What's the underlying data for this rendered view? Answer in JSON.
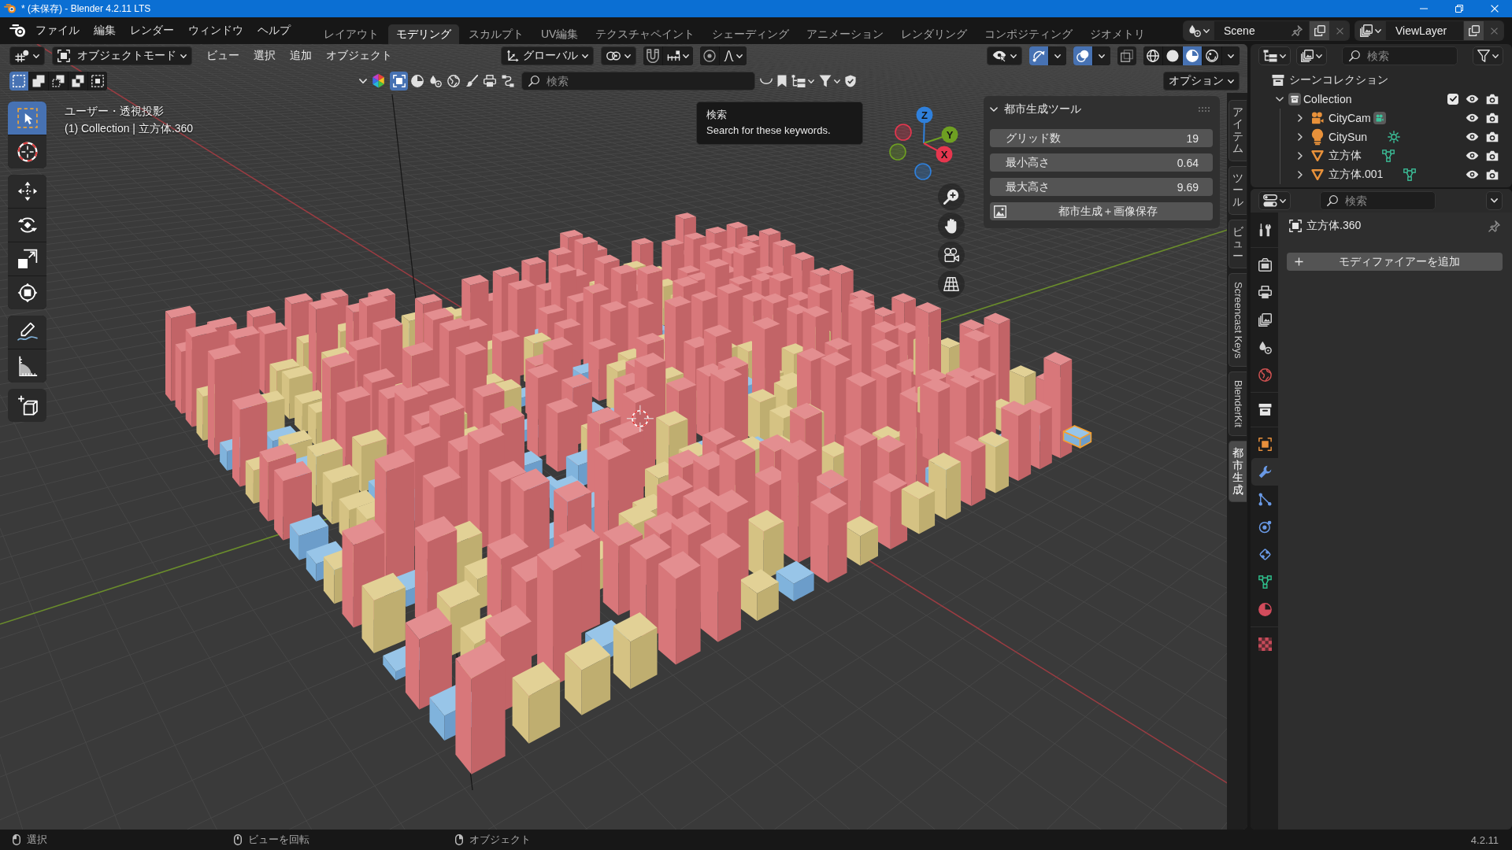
{
  "title_bar": {
    "title": "* (未保存) - Blender 4.2.11 LTS"
  },
  "top_bar": {
    "menus": [
      "ファイル",
      "編集",
      "レンダー",
      "ウィンドウ",
      "ヘルプ"
    ],
    "workspaces": [
      {
        "label": "レイアウト",
        "selected": false
      },
      {
        "label": "モデリング",
        "selected": true
      },
      {
        "label": "スカルプト",
        "selected": false
      },
      {
        "label": "UV編集",
        "selected": false
      },
      {
        "label": "テクスチャペイント",
        "selected": false
      },
      {
        "label": "シェーディング",
        "selected": false
      },
      {
        "label": "アニメーション",
        "selected": false
      },
      {
        "label": "レンダリング",
        "selected": false
      },
      {
        "label": "コンポジティング",
        "selected": false
      },
      {
        "label": "ジオメトリ",
        "selected": false
      }
    ],
    "scene": "Scene",
    "view_layer": "ViewLayer"
  },
  "viewport": {
    "header": {
      "mode": "オブジェクトモード",
      "menus": [
        "ビュー",
        "選択",
        "追加",
        "オブジェクト"
      ],
      "orientation": "グローバル",
      "snap": {
        "on": false
      },
      "proportional": {
        "on": false
      },
      "gizmos": {
        "on": true
      },
      "overlays": {
        "on": true
      },
      "xray": {
        "on": false
      },
      "shading_modes": [
        {
          "kind": "wireframe",
          "selected": false
        },
        {
          "kind": "solid",
          "selected": false
        },
        {
          "kind": "material",
          "selected": true
        },
        {
          "kind": "rendered",
          "selected": false
        }
      ]
    },
    "select_modes": [
      {
        "kind": "set",
        "selected": true
      },
      {
        "kind": "extend",
        "selected": false
      },
      {
        "kind": "subtract",
        "selected": false
      },
      {
        "kind": "invert",
        "selected": false
      },
      {
        "kind": "intersect",
        "selected": false
      }
    ],
    "asset_bar": {
      "asset_types": [
        {
          "kind": "model",
          "selected": true
        },
        {
          "kind": "material",
          "selected": false
        },
        {
          "kind": "scene",
          "selected": false
        },
        {
          "kind": "world",
          "selected": false
        },
        {
          "kind": "brush",
          "selected": false
        },
        {
          "kind": "printable",
          "selected": false
        },
        {
          "kind": "nodegroup",
          "selected": false
        }
      ],
      "search": {
        "placeholder": "検索"
      }
    },
    "options_menu": "オプション",
    "tooltip": {
      "title": "検索",
      "text": "Search for these keywords."
    },
    "view_name": "ユーザー・透視投影",
    "collection_info": "(1) Collection | 立方体.360",
    "toolbar": {
      "groups": [
        {
          "tools": [
            {
              "kind": "select",
              "selected": true
            },
            {
              "kind": "cursor",
              "selected": false
            }
          ]
        },
        {
          "tools": [
            {
              "kind": "move",
              "selected": false
            },
            {
              "kind": "rotate",
              "selected": false
            },
            {
              "kind": "scale",
              "selected": false
            },
            {
              "kind": "transform",
              "selected": false
            }
          ]
        },
        {
          "tools": [
            {
              "kind": "annotate",
              "selected": false
            },
            {
              "kind": "measure",
              "selected": false
            }
          ]
        },
        {
          "tools": [
            {
              "kind": "cube",
              "selected": false
            }
          ]
        }
      ]
    },
    "navigation_gizmo": {
      "axes": [
        {
          "label": "Z",
          "color": "#2f80dc"
        },
        {
          "label": "Y",
          "color": "#6e9f22"
        },
        {
          "label": "X",
          "color": "#e6364e"
        }
      ]
    },
    "sidebar_panel": {
      "title": "都市生成ツール",
      "expanded": true,
      "fields": [
        {
          "label": "グリッド数",
          "value": "19"
        },
        {
          "label": "最小高さ",
          "value": "0.64"
        },
        {
          "label": "最大高さ",
          "value": "9.69"
        }
      ],
      "button": "都市生成＋画像保存"
    },
    "sidebar_tabs": [
      {
        "label": "アイテム",
        "selected": false
      },
      {
        "label": "ツール",
        "selected": false
      },
      {
        "label": "ビュー",
        "selected": false
      },
      {
        "label": "Screencast Keys",
        "selected": false
      },
      {
        "label": "BlenderKit",
        "selected": false
      },
      {
        "label": "都市生成",
        "selected": true
      }
    ]
  },
  "outliner": {
    "search": {
      "placeholder": "検索"
    },
    "tree": [
      {
        "name": "シーンコレクション",
        "kind": "scene",
        "children": [
          {
            "name": "Collection",
            "kind": "collection",
            "expanded": true,
            "active": true,
            "checked": true,
            "visible": true,
            "renderable": true,
            "children": [
              {
                "name": "CityCam",
                "kind": "camera",
                "expanded": false,
                "active": false,
                "data_active": true,
                "visible": true,
                "renderable": true
              },
              {
                "name": "CitySun",
                "kind": "light",
                "expanded": false,
                "active": false,
                "data_active": false,
                "visible": true,
                "renderable": true
              },
              {
                "name": "立方体",
                "kind": "mesh",
                "expanded": false,
                "active": false,
                "data_active": false,
                "visible": true,
                "renderable": true
              },
              {
                "name": "立方体.001",
                "kind": "mesh",
                "expanded": false,
                "active": false,
                "data_active": false,
                "visible": true,
                "renderable": true
              }
            ]
          }
        ]
      }
    ]
  },
  "properties": {
    "search": {
      "placeholder": "検索"
    },
    "tab_groups": [
      {
        "tabs": [
          {
            "kind": "tool",
            "selected": false
          }
        ]
      },
      {
        "tabs": [
          {
            "kind": "render",
            "selected": false
          },
          {
            "kind": "output",
            "selected": false
          },
          {
            "kind": "viewlayer",
            "selected": false
          },
          {
            "kind": "scene",
            "selected": false
          },
          {
            "kind": "world",
            "selected": false
          }
        ]
      },
      {
        "tabs": [
          {
            "kind": "collection",
            "selected": false
          }
        ]
      },
      {
        "tabs": [
          {
            "kind": "object",
            "selected": false
          },
          {
            "kind": "modifiers",
            "selected": true
          },
          {
            "kind": "particles",
            "selected": false
          },
          {
            "kind": "physics",
            "selected": false
          },
          {
            "kind": "constraints",
            "selected": false
          },
          {
            "kind": "data",
            "selected": false
          },
          {
            "kind": "material",
            "selected": false
          }
        ]
      },
      {
        "tabs": [
          {
            "kind": "texture",
            "selected": false
          }
        ]
      }
    ],
    "object_name": "立方体.360",
    "add_modifier": "モディファイアーを追加"
  },
  "status_bar": {
    "hints": [
      {
        "kind": "left",
        "label": "選択"
      },
      {
        "kind": "middle",
        "label": "ビューを回転"
      },
      {
        "kind": "right",
        "label": "オブジェクト"
      }
    ],
    "version": "4.2.11"
  }
}
